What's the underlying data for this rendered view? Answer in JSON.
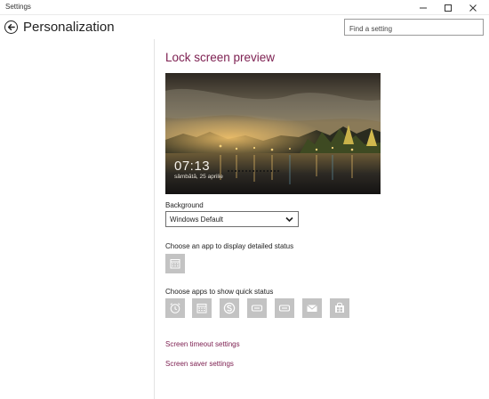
{
  "window": {
    "title": "Settings"
  },
  "header": {
    "title": "Personalization"
  },
  "search": {
    "placeholder": "Find a setting"
  },
  "lock_screen": {
    "heading": "Lock screen preview",
    "preview": {
      "time": "07:13",
      "date": "sâmbătă, 25 aprilie"
    },
    "background": {
      "label": "Background",
      "selected": "Windows Default"
    },
    "detailed_status_label": "Choose an app to display detailed status",
    "detailed_status_app": "calendar-icon",
    "quick_status_label": "Choose apps to show quick status",
    "quick_status_apps": [
      "alarm-clock-icon",
      "calendar-icon",
      "skype-icon",
      "phone-icon",
      "messaging-icon",
      "mail-icon",
      "store-icon"
    ],
    "links": {
      "screen_timeout": "Screen timeout settings",
      "screen_saver": "Screen saver settings"
    }
  },
  "colors": {
    "accent": "#7e2152",
    "tile": "#c3c3c3"
  }
}
